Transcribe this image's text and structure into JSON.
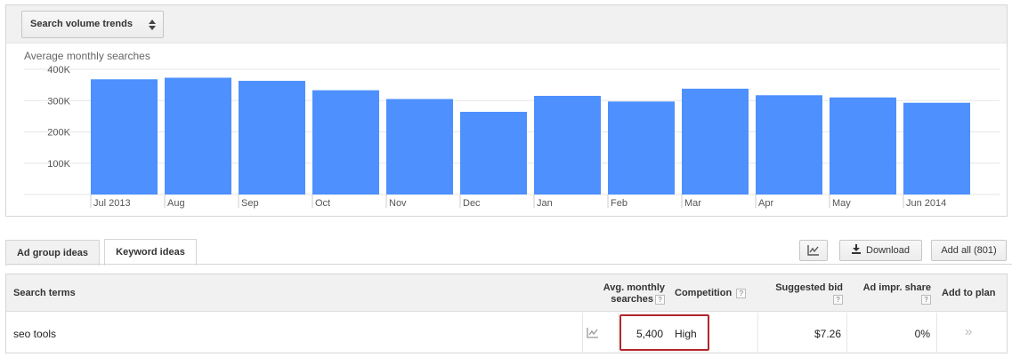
{
  "toolbar": {
    "dropdown_label": "Search volume trends"
  },
  "chart_data": {
    "type": "bar",
    "title": "Average monthly searches",
    "categories": [
      "Jul 2013",
      "Aug",
      "Sep",
      "Oct",
      "Nov",
      "Dec",
      "Jan",
      "Feb",
      "Mar",
      "Apr",
      "May",
      "Jun 2014"
    ],
    "values": [
      368000,
      373000,
      363000,
      333000,
      305000,
      264000,
      315000,
      297000,
      338000,
      317000,
      310000,
      293000
    ],
    "yticks": [
      {
        "value": 100000,
        "label": "100K"
      },
      {
        "value": 200000,
        "label": "200K"
      },
      {
        "value": 300000,
        "label": "300K"
      },
      {
        "value": 400000,
        "label": "400K"
      }
    ],
    "ylim": [
      0,
      400000
    ],
    "grid": true,
    "bar_color": "#4d90fe"
  },
  "tabs": [
    {
      "label": "Ad group ideas",
      "active": false
    },
    {
      "label": "Keyword ideas",
      "active": true
    }
  ],
  "actions": {
    "chart_icon": "line-chart-icon",
    "download_label": "Download",
    "add_all_label": "Add all (801)"
  },
  "table": {
    "headers": {
      "search_terms": "Search terms",
      "avg_monthly_1": "Avg. monthly",
      "avg_monthly_2": "searches",
      "competition": "Competition",
      "suggested_bid": "Suggested bid",
      "ad_impr_share": "Ad impr. share",
      "add_to_plan": "Add to plan"
    },
    "help_glyph": "?",
    "rows": [
      {
        "term": "seo tools",
        "avg_monthly_searches": "5,400",
        "competition": "High",
        "suggested_bid": "$7.26",
        "ad_impr_share": "0%",
        "add_glyph": "»"
      }
    ]
  },
  "colors": {
    "highlight_border": "#b0262a",
    "header_bg": "#f1f1f1"
  }
}
